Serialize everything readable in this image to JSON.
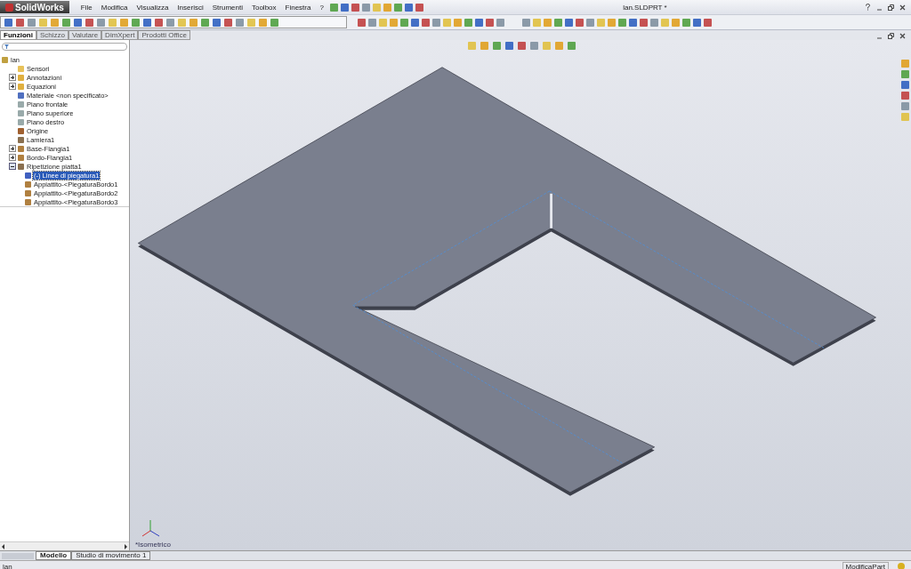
{
  "app": {
    "logo": "SolidWorks",
    "menu": [
      "File",
      "Modifica",
      "Visualizza",
      "Inserisci",
      "Strumenti",
      "Toolbox",
      "Finestra",
      "?"
    ],
    "title": "lan.SLDPRT *"
  },
  "command_tabs": [
    {
      "label": "Funzioni",
      "selected": true
    },
    {
      "label": "Schizzo",
      "selected": false
    },
    {
      "label": "Valutare",
      "selected": false
    },
    {
      "label": "DimXpert",
      "selected": false
    },
    {
      "label": "Prodotti Office",
      "selected": false
    }
  ],
  "feature_tree": {
    "root": "lan",
    "items": [
      {
        "label": "Sensori",
        "kind": "folder",
        "selected": false
      },
      {
        "label": "Annotazioni",
        "kind": "annotation",
        "expanded": false,
        "selected": false
      },
      {
        "label": "Equazioni",
        "kind": "equation",
        "expanded": false,
        "selected": false
      },
      {
        "label": "Materiale <non specificato>",
        "kind": "material",
        "selected": false
      },
      {
        "label": "Piano frontale",
        "kind": "plane",
        "selected": false
      },
      {
        "label": "Piano superiore",
        "kind": "plane",
        "selected": false
      },
      {
        "label": "Piano destro",
        "kind": "plane",
        "selected": false
      },
      {
        "label": "Origine",
        "kind": "origin",
        "selected": false
      },
      {
        "label": "Lamiera1",
        "kind": "sheet",
        "selected": false
      },
      {
        "label": "Base-Flangia1",
        "kind": "feature",
        "expanded": false,
        "selected": false
      },
      {
        "label": "Bordo-Flangia1",
        "kind": "feature",
        "expanded": false,
        "selected": false
      },
      {
        "label": "Ripetizione piatta1",
        "kind": "sheet",
        "expanded": true,
        "selected": false,
        "children": [
          {
            "label": "(-) Linee di piegatura1",
            "kind": "sketch",
            "selected": true
          },
          {
            "label": "Appiattito-<PiegaturaBordo1",
            "kind": "feature",
            "selected": false
          },
          {
            "label": "Appiattito-<PiegaturaBordo2",
            "kind": "feature",
            "selected": false
          },
          {
            "label": "Appiattito-<PiegaturaBordo3",
            "kind": "feature",
            "selected": false
          }
        ]
      }
    ]
  },
  "viewport": {
    "view_name": "*Isometrico"
  },
  "bottom_tabs": [
    {
      "label": "Modello",
      "selected": true
    },
    {
      "label": "Studio di movimento 1",
      "selected": false
    }
  ],
  "status_bar": {
    "left": "lan",
    "mode": "ModificaPart"
  }
}
